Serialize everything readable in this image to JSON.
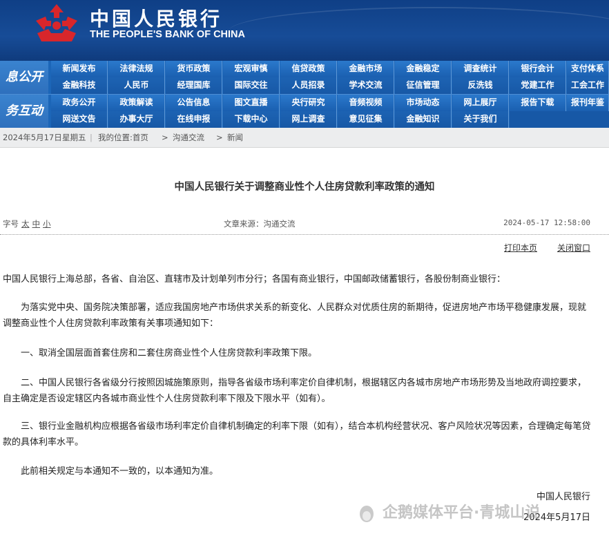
{
  "header": {
    "cn_name": "中国人民银行",
    "en_name": "THE PEOPLE'S BANK OF CHINA",
    "logo_icon": "pboc-logo-icon"
  },
  "nav": {
    "row1_label": "息公开",
    "row2_label": "务互动",
    "row1_top": [
      "新闻发布",
      "法律法规",
      "货币政策",
      "宏观审慎",
      "信贷政策",
      "金融市场",
      "金融稳定",
      "调查统计",
      "银行会计",
      "支付体系"
    ],
    "row1_bottom": [
      "金融科技",
      "人民币",
      "经理国库",
      "国际交往",
      "人员招录",
      "学术交流",
      "征信管理",
      "反洗钱",
      "党建工作",
      "工会工作"
    ],
    "row2_top": [
      "政务公开",
      "政策解读",
      "公告信息",
      "图文直播",
      "央行研究",
      "音频视频",
      "市场动态",
      "网上展厅",
      "报告下载",
      "报刊年鉴"
    ],
    "row2_bottom": [
      "网送文告",
      "办事大厅",
      "在线申报",
      "下载中心",
      "网上调查",
      "意见征集",
      "金融知识",
      "关于我们"
    ]
  },
  "breadcrumb": {
    "date": "2024年5月17日",
    "weekday": "星期五",
    "location_label": "我的位置:首页",
    "sep1": ">",
    "level2": "沟通交流",
    "sep2": ">",
    "level3": "新闻"
  },
  "article": {
    "title": "中国人民银行关于调整商业性个人住房贷款利率政策的通知",
    "font_size_label": "字号",
    "font_large": "太",
    "font_medium": "中",
    "font_small": "小",
    "source": "文章来源：沟通交流",
    "datetime": "2024-05-17 12:58:00",
    "print_label": "打印本页",
    "close_label": "关闭窗口",
    "salutation": "中国人民银行上海总部，各省、自治区、直辖市及计划单列市分行；各国有商业银行，中国邮政储蓄银行，各股份制商业银行：",
    "para1": "为落实党中央、国务院决策部署，适应我国房地产市场供求关系的新变化、人民群众对优质住房的新期待，促进房地产市场平稳健康发展，现就调整商业性个人住房贷款利率政策有关事项通知如下：",
    "para2": "一、取消全国层面首套住房和二套住房商业性个人住房贷款利率政策下限。",
    "para3": "二、中国人民银行各省级分行按照因城施策原则，指导各省级市场利率定价自律机制，根据辖区内各城市房地产市场形势及当地政府调控要求，自主确定是否设定辖区内各城市商业性个人住房贷款利率下限及下限水平（如有）。",
    "para4": "三、银行业金融机构应根据各省级市场利率定价自律机制确定的利率下限（如有），结合本机构经营状况、客户风险状况等因素，合理确定每笔贷款的具体利率水平。",
    "para5": "此前相关规定与本通知不一致的，以本通知为准。",
    "signoff_org": "中国人民银行",
    "signoff_date": "2024年5月17日"
  },
  "watermark": {
    "text": "企鹅媒体平台·青城山说",
    "icon": "penguin-icon"
  }
}
